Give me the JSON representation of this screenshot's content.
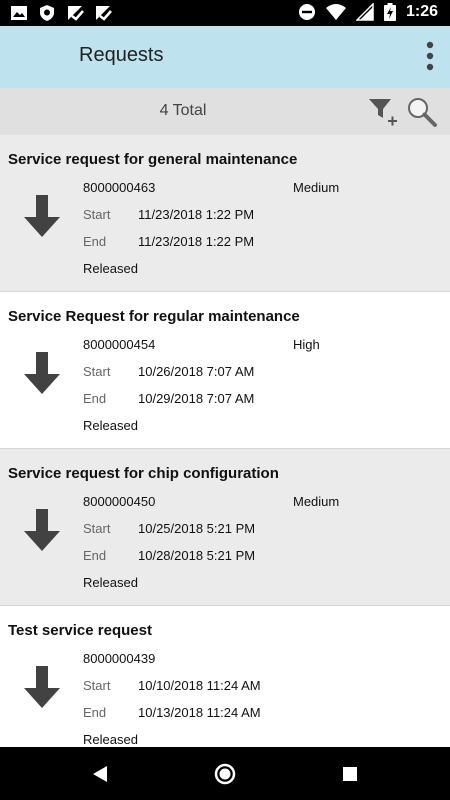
{
  "status_bar": {
    "time": "1:26",
    "left_icons": [
      "image-icon",
      "shield-icon",
      "check-badge-icon",
      "check-badge-icon"
    ],
    "right_icons": [
      "dnd-icon",
      "wifi-icon",
      "signal-icon",
      "battery-charging-icon"
    ]
  },
  "app_bar": {
    "title": "Requests",
    "overflow_icon": "more-vertical-icon",
    "color": "#bfe3ee"
  },
  "filter_bar": {
    "total": "4 Total",
    "filter_icon": "filter-add-icon",
    "search_icon": "search-icon"
  },
  "labels": {
    "start": "Start",
    "end": "End"
  },
  "requests": [
    {
      "title": "Service request for general maintenance",
      "number": "8000000463",
      "priority": "Medium",
      "start": "11/23/2018 1:22 PM",
      "end": "11/23/2018 1:22 PM",
      "status": "Released",
      "icon": "arrow-down-icon"
    },
    {
      "title": "Service Request for regular maintenance",
      "number": "8000000454",
      "priority": "High",
      "start": "10/26/2018 7:07 AM",
      "end": "10/29/2018 7:07 AM",
      "status": "Released",
      "icon": "arrow-down-icon"
    },
    {
      "title": "Service request for chip configuration",
      "number": "8000000450",
      "priority": "Medium",
      "start": "10/25/2018 5:21 PM",
      "end": "10/28/2018 5:21 PM",
      "status": "Released",
      "icon": "arrow-down-icon"
    },
    {
      "title": "Test service request",
      "number": "8000000439",
      "priority": "",
      "start": "10/10/2018 11:24 AM",
      "end": "10/13/2018 11:24 AM",
      "status": "Released",
      "icon": "arrow-down-icon"
    }
  ],
  "nav_bar": {
    "icons": [
      "back-icon",
      "home-icon",
      "recents-icon"
    ]
  }
}
